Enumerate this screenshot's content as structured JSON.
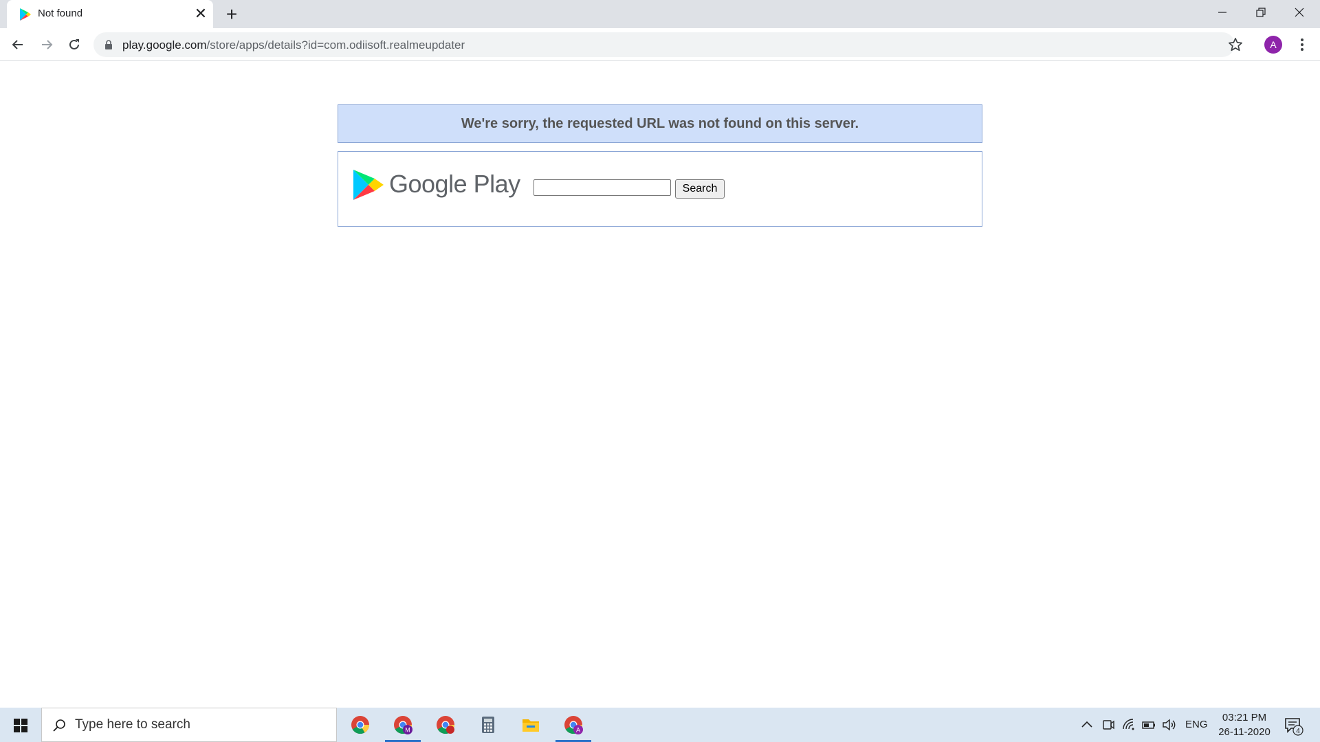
{
  "browser": {
    "tab_title": "Not found",
    "tab_close": "✕",
    "new_tab": "+",
    "url_host": "play.google.com",
    "url_path": "/store/apps/details?id=com.odiisoft.realmeupdater",
    "avatar_letter": "A",
    "avatar_color": "#8e24aa"
  },
  "page": {
    "error_message": "We're sorry, the requested URL was not found on this server.",
    "brand_wordmark": "Google Play",
    "search_value": "",
    "search_button": "Search"
  },
  "taskbar": {
    "search_placeholder": "Type here to search",
    "language": "ENG",
    "time": "03:21 PM",
    "date": "26-11-2020",
    "notification_count": "4",
    "pinned_apps": [
      "chrome",
      "chrome-profile-m",
      "chrome-red",
      "calculator",
      "file-explorer",
      "chrome-profile-a"
    ]
  }
}
